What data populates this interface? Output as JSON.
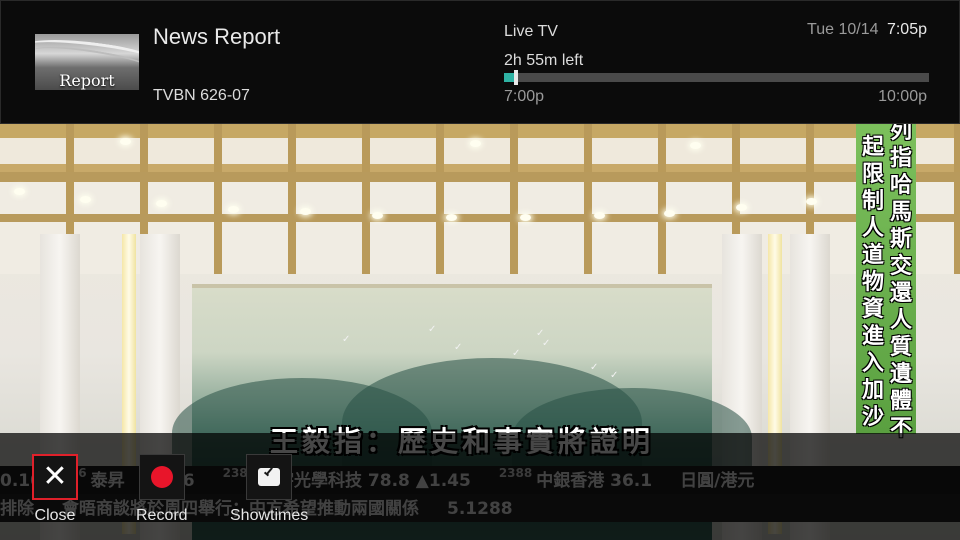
{
  "header": {
    "show_title": "News Report",
    "thumbnail_text": "Report",
    "channel": "TVBN 626-07",
    "status_label": "Live TV",
    "time_left": "2h 55m left",
    "start_time": "7:00p",
    "end_time": "10:00p",
    "progress_fraction": 0.028,
    "date": "Tue 10/14",
    "time": "7:05p",
    "accent_color": "#2fb3a4"
  },
  "video": {
    "vertical_caption_right": "列指哈馬斯交還人質遺體不",
    "vertical_caption_left": "起限制人道物資進入加沙",
    "subtitle": "王毅指：歷史和事實將證明",
    "ticker_row_1": [
      {
        "num": "",
        "text": "0.10"
      },
      {
        "num": "66",
        "text": "泰昇"
      },
      {
        "num": "",
        "text": "94.6"
      },
      {
        "num": "2382",
        "text": "舜宇光學科技 78.8 ▲1.45"
      },
      {
        "num": "2388",
        "text": "中銀香港 36.1"
      },
      {
        "num": "",
        "text": "日圓/港元"
      }
    ],
    "ticker_row_2": [
      {
        "num": "",
        "text": "排除"
      },
      {
        "num": "",
        "text": "會晤商談將於周四舉行；中方希望推動兩國關係"
      },
      {
        "num": "",
        "text": "5.1288"
      }
    ]
  },
  "actions": [
    {
      "id": "close",
      "label": "Close",
      "icon": "close-icon",
      "selected": true
    },
    {
      "id": "record",
      "label": "Record",
      "icon": "record-icon",
      "selected": false
    },
    {
      "id": "showtimes",
      "label": "Showtimes",
      "icon": "clock-icon",
      "selected": false
    }
  ],
  "colors": {
    "record_red": "#e8152a",
    "selection_red": "#e0202a",
    "caption_green": "#6cb04c"
  }
}
